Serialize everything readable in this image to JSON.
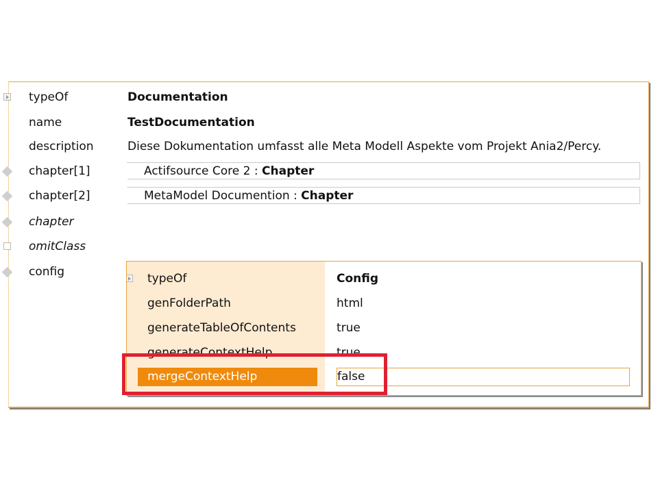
{
  "properties": [
    {
      "label": "typeOf",
      "value": "Documentation"
    },
    {
      "label": "name",
      "value": "TestDocumentation"
    },
    {
      "label": "description",
      "value": "Diese Dokumentation umfasst alle Meta Modell Aspekte vom Projekt Ania2/Percy."
    },
    {
      "label": "chapter[1]",
      "ref_name": "Actifsource Core 2",
      "ref_sep": ":",
      "ref_type": "Chapter"
    },
    {
      "label": "chapter[2]",
      "ref_name": "MetaModel Documention",
      "ref_sep": ":",
      "ref_type": "Chapter"
    },
    {
      "label": "chapter"
    },
    {
      "label": "omitClass"
    },
    {
      "label": "config"
    }
  ],
  "config": [
    {
      "label": "typeOf",
      "value": "Config"
    },
    {
      "label": "genFolderPath",
      "value": "html"
    },
    {
      "label": "generateTableOfContents",
      "value": "true"
    },
    {
      "label": "generateContextHelp",
      "value": "true"
    },
    {
      "label": "mergeContextHelp",
      "value": "false"
    }
  ],
  "colors": {
    "accent": "#e9a23b",
    "selection": "#ef8a0c",
    "label_column": "#fdebd2",
    "highlight": "#e02032"
  },
  "icons": {
    "expander": "expander-icon",
    "multi_ref": "diamond-icon",
    "checkbox": "checkbox-icon"
  }
}
